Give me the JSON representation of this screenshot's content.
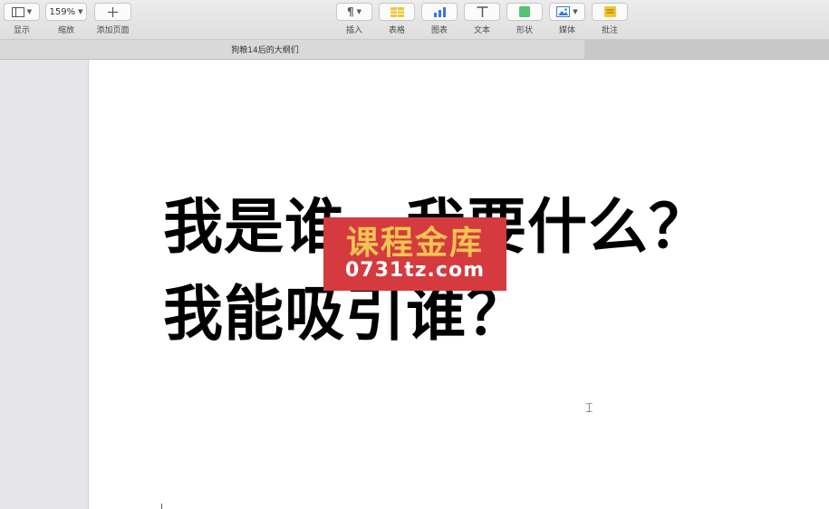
{
  "toolbar": {
    "view_label": "显示",
    "zoom_value": "159%",
    "zoom_label": "缩放",
    "add_page_label": "添加页面",
    "insert_label": "插入",
    "table_label": "表格",
    "chart_label": "图表",
    "text_label": "文本",
    "shape_label": "形状",
    "media_label": "媒体",
    "comment_label": "批注"
  },
  "document": {
    "title": "狗粮14后的大纲们",
    "line1": "我是谁，我要什么？",
    "line2": "我能吸引谁？"
  },
  "watermark": {
    "text_cn": "课程金库",
    "url": "0731tz.com"
  },
  "colors": {
    "watermark_bg": "#d53a3e",
    "watermark_gold": "#f2c452"
  }
}
